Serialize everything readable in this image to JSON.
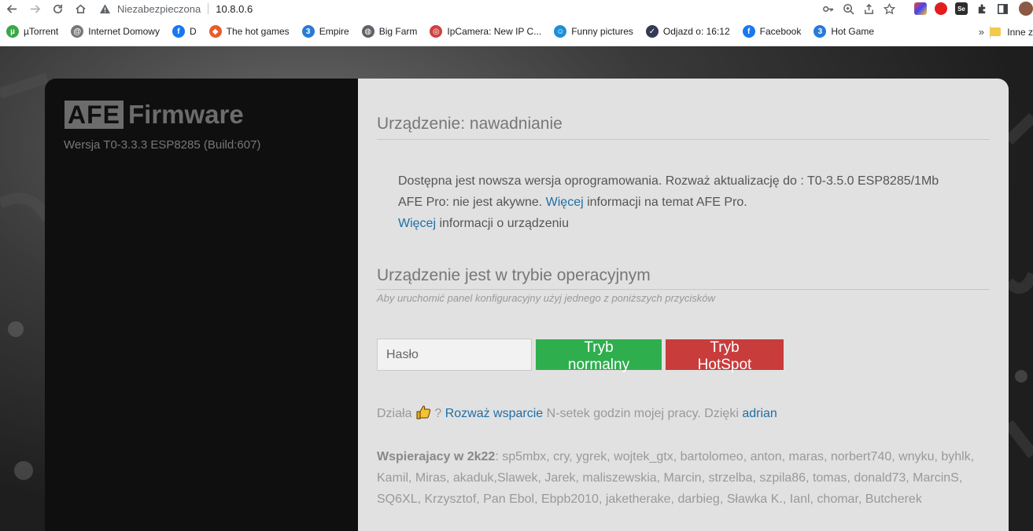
{
  "browser": {
    "security_label": "Niezabezpieczona",
    "url": "10.8.0.6",
    "colors": {
      "warning": "#5f6368",
      "link": "#1d6fa5"
    }
  },
  "bookmarks": [
    {
      "label": "µTorrent",
      "icon": "utorrent-icon",
      "color": "#3aa845",
      "glyph": "µ"
    },
    {
      "label": "Internet Domowy",
      "icon": "at-icon",
      "color": "#777777",
      "glyph": "@"
    },
    {
      "label": "D",
      "icon": "facebook-icon",
      "color": "#1877f2",
      "glyph": "f"
    },
    {
      "label": "The hot games",
      "icon": "hotgames-icon",
      "color": "#e85d2a",
      "glyph": "◆"
    },
    {
      "label": "Empire",
      "icon": "empire-icon",
      "color": "#2a7ad8",
      "glyph": "3"
    },
    {
      "label": "Big Farm",
      "icon": "globe-icon",
      "color": "#5f6368",
      "glyph": "◍"
    },
    {
      "label": "IpCamera: New IP C...",
      "icon": "ipcamera-icon",
      "color": "#d04040",
      "glyph": "◎"
    },
    {
      "label": "Funny pictures",
      "icon": "funny-icon",
      "color": "#1d8fd8",
      "glyph": "☺"
    },
    {
      "label": "Odjazd o: 16:12",
      "icon": "check-icon",
      "color": "#333a55",
      "glyph": "✓"
    },
    {
      "label": "Facebook",
      "icon": "facebook-icon",
      "color": "#1877f2",
      "glyph": "f"
    },
    {
      "label": "Hot Game",
      "icon": "hotgame-icon",
      "color": "#2a7ad8",
      "glyph": "3"
    }
  ],
  "bookmarks_more": "»",
  "bookmarks_other": "Inne z",
  "sidebar": {
    "logo_box": "AFE",
    "logo_text": "Firmware",
    "version": "Wersja T0-3.3.3 ESP8285 (Build:607)"
  },
  "main": {
    "device_title": "Urządzenie: nawadnianie",
    "update_line": "Dostępna jest nowsza wersja oprogramowania. Rozważ aktualizację do : T0-3.5.0 ESP8285/1Mb",
    "pro_prefix": "AFE Pro: nie jest akywne. ",
    "more_link_1": "Więcej",
    "pro_suffix": " informacji na temat AFE Pro.",
    "more_link_2": "Więcej",
    "device_info_suffix": " informacji o urządzeniu",
    "mode_title": "Urządzenie jest w trybie operacyjnym",
    "mode_subtitle": "Aby uruchomić panel konfiguracyjny użyj jednego z poniższych przycisków",
    "password_placeholder": "Hasło",
    "btn_normal": "Tryb normalny",
    "btn_hotspot": "Tryb HotSpot",
    "support_prefix": "Działa ",
    "support_q": " ? ",
    "support_link": "Rozważ wsparcie",
    "support_middle": " N-setek godzin mojej pracy. Dzięki ",
    "support_author": "adrian",
    "supporters_label": "Wspierajacy w 2k22",
    "supporters_list": ": sp5mbx, cry, ygrek, wojtek_gtx, bartolomeo, anton, maras, norbert740, wnyku, byhlk, Kamil, Miras, akaduk,Slawek, Jarek, maliszewskia, Marcin, strzelba, szpila86, tomas, donald73, MarcinS, SQ6XL, Krzysztof, Pan Ebol, Ebpb2010, jaketherake, darbieg, Sławka K., Ianl, chomar, Butcherek"
  }
}
